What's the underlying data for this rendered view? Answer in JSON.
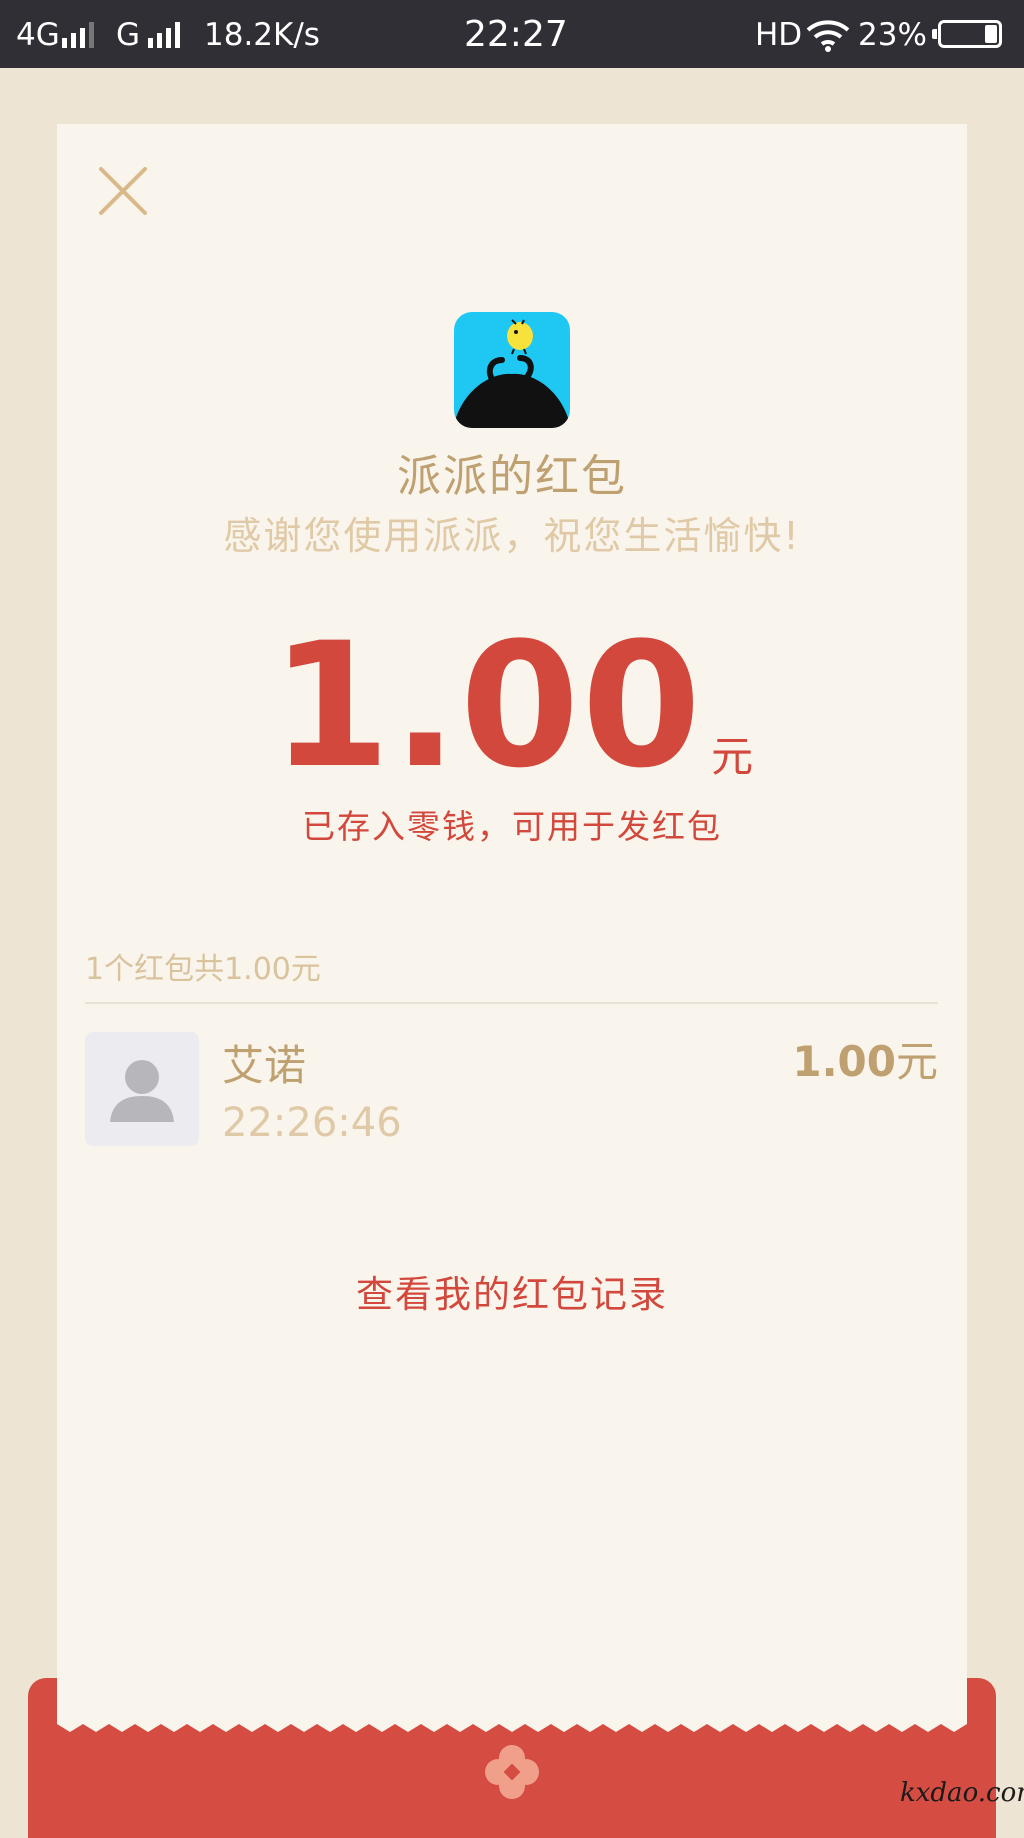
{
  "status_bar": {
    "network_1": "4G",
    "network_2": "G",
    "speed": "18.2K/s",
    "time": "22:27",
    "hd": "HD",
    "battery_percent": "23%",
    "battery_level": 0.23,
    "icons": [
      "signal-icon",
      "wifi-icon",
      "battery-icon"
    ]
  },
  "red_packet": {
    "sender_title": "派派的红包",
    "greeting": "感谢您使用派派，祝您生活愉快!",
    "amount": "1.00",
    "amount_unit": "元",
    "saved_note": "已存入零钱，可用于发红包",
    "summary": "1个红包共1.00元",
    "recipients": [
      {
        "name": "艾诺",
        "time": "22:26:46",
        "amount": "1.00",
        "unit": "元"
      }
    ],
    "history_link": "查看我的红包记录"
  },
  "watermark": "kxdao.com",
  "colors": {
    "accent_red": "#d2483c",
    "gold": "#bfa071",
    "light_gold": "#e0c9a6",
    "card_bg": "#faf5ec",
    "page_bg": "#ede4d3",
    "envelope_red": "#d54d42",
    "logo_blue": "#1ec8f2"
  }
}
